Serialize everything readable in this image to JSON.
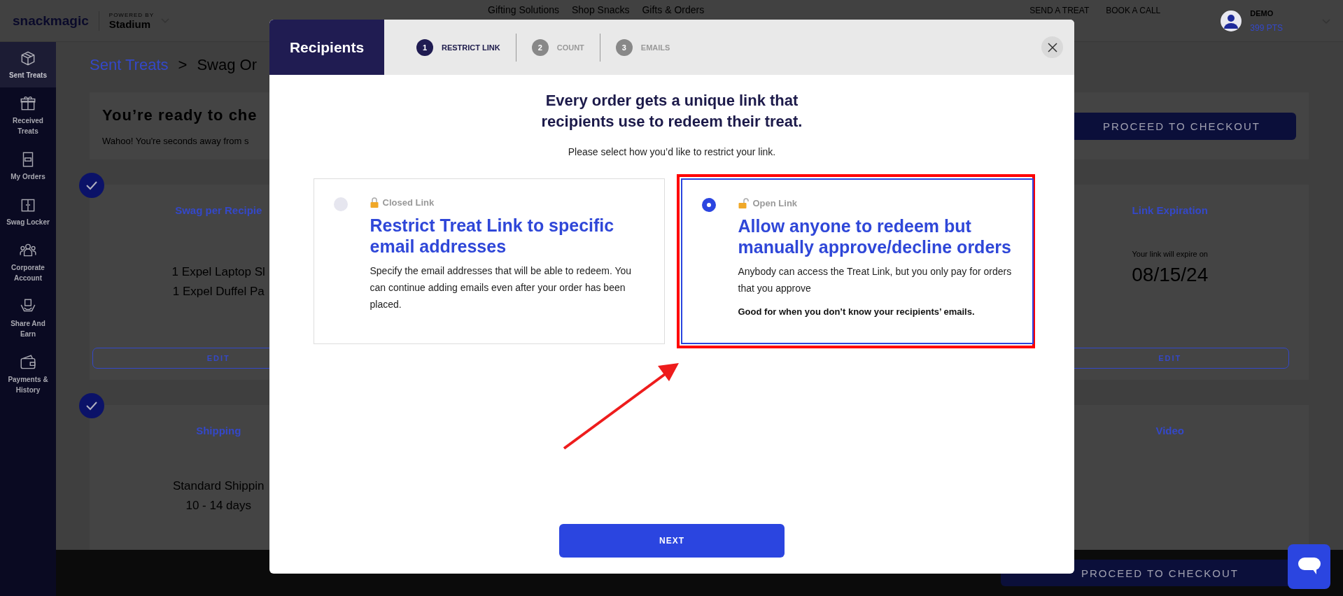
{
  "top_bar": {
    "logo": "snackmagic",
    "powered_by": "POWERED BY",
    "partner": "Stadium",
    "nav": [
      "Gifting Solutions",
      "Shop Snacks",
      "Gifts & Orders"
    ],
    "links": [
      "SEND A TREAT",
      "BOOK A CALL"
    ],
    "user": {
      "name": "DEMO",
      "points": "399 PTS"
    }
  },
  "sidebar": {
    "items": [
      {
        "label": "Sent Treats",
        "selected": true
      },
      {
        "label": "Received Treats",
        "selected": false
      },
      {
        "label": "My Orders",
        "selected": false
      },
      {
        "label": "Swag Locker",
        "selected": false
      },
      {
        "label": "Corporate Account",
        "selected": false
      },
      {
        "label": "Share And Earn",
        "selected": false
      },
      {
        "label": "Payments & History",
        "selected": false
      }
    ]
  },
  "page": {
    "breadcrumb": [
      "Sent Treats",
      "Swag Or"
    ],
    "breadcrumb_separator": ">",
    "ready_card": {
      "title": "You’re ready to che",
      "text": "Wahoo! You're seconds away from s",
      "button": "PROCEED TO CHECKOUT"
    },
    "sections": [
      {
        "columns": [
          {
            "heading": "Swag per Recipie",
            "lines": [
              "1 Expel Laptop Sl",
              "1 Expel Duffel Pa"
            ],
            "button": "EDIT"
          },
          {
            "heading": "Link Expiration",
            "caption": "Your link will expire on",
            "value": "08/15/24",
            "button": "EDIT"
          }
        ]
      },
      {
        "columns": [
          {
            "heading": "Shipping",
            "lines": [
              "Standard Shippin",
              "10 - 14 days"
            ]
          },
          {
            "heading": "Video"
          }
        ]
      }
    ]
  },
  "bottom_bar": {
    "button": "PROCEED TO CHECKOUT"
  },
  "modal": {
    "title": "Recipients",
    "steps": [
      {
        "number": "1",
        "label": "RESTRICT LINK",
        "selected": true
      },
      {
        "number": "2",
        "label": "COUNT",
        "selected": false
      },
      {
        "number": "3",
        "label": "EMAILS",
        "selected": false
      }
    ],
    "heading": "Every order gets a unique link that recipients use to redeem their treat.",
    "subheading": "Please select how you’d like to restrict your link.",
    "options": [
      {
        "kind": "closed",
        "tag": "Closed Link",
        "title": "Restrict Treat Link to specific email addresses",
        "description": "Specify the email addresses that will be able to redeem. You can continue adding emails even after your order has been placed.",
        "selected": false,
        "highlighted": false
      },
      {
        "kind": "open",
        "tag": "Open Link",
        "title": "Allow anyone to redeem but manually approve/decline orders",
        "description": "Anybody can access the Treat Link, but you only pay for orders that you approve",
        "note": "Good for when you don’t know your recipients’ emails.",
        "selected": true,
        "highlighted": true
      }
    ],
    "button": "NEXT"
  }
}
